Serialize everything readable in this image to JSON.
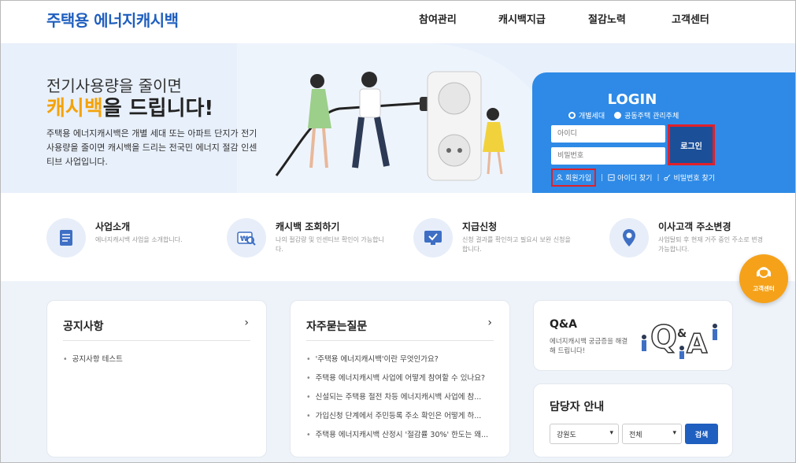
{
  "header": {
    "logo": "주택용 에너지캐시백",
    "nav": [
      "참여관리",
      "캐시백지급",
      "절감노력",
      "고객센터"
    ]
  },
  "hero": {
    "line1": "전기사용량을 줄이면",
    "line2_accent": "캐시백",
    "line2_rest": "을 드립니다!",
    "desc": "주택용 에너지캐시백은 개별 세대 또는 아파트 단지가 전기사용량을 줄이면 캐시백을 드리는 전국민 에너지 절감 인센티브 사업입니다."
  },
  "login": {
    "title": "LOGIN",
    "radio_household": "개별세대",
    "radio_apartment": "공동주택 관리주체",
    "id_placeholder": "아이디",
    "pw_placeholder": "비밀번호",
    "login_button": "로그인",
    "signup": "회원가입",
    "find_id": "아이디 찾기",
    "find_pw": "비밀번호 찾기"
  },
  "services": [
    {
      "title": "사업소개",
      "desc": "에너지캐시백 사업을 소개합니다."
    },
    {
      "title": "캐시백 조회하기",
      "desc": "나의 절감량 및 인센티브 확인이 가능합니다."
    },
    {
      "title": "지급신청",
      "desc": "신청 결과를 확인하고 필요시 보완 신청을 합니다."
    },
    {
      "title": "이사고객 주소변경",
      "desc": "사업탈퇴 후 현재 거주 중인 주소로 변경 가능합니다."
    }
  ],
  "notice": {
    "title": "공지사항",
    "arrow": "›",
    "items": [
      "공지사항 테스트"
    ]
  },
  "faq": {
    "title": "자주묻는질문",
    "arrow": "›",
    "items": [
      "'주택용 에너지캐시백'이란 무엇인가요?",
      "주택용 에너지캐시백 사업에 어떻게 참여할 수 있나요?",
      "신설되는 주택용 절전 차등 에너지캐시백 사업에 참...",
      "가입신청 단계에서 주민등록 주소 확인은 어떻게 하...",
      "주택용 에너지캐시백 산정시 '절감률 30%' 한도는 왜..."
    ]
  },
  "qa": {
    "title": "Q&A",
    "desc": "에너지캐시백 궁금증을 해결해 드립니다!"
  },
  "contact": {
    "title": "담당자 안내",
    "region": "강원도",
    "scope": "전체",
    "search": "검색"
  },
  "cs_float": "고객센터",
  "colors": {
    "brand": "#1f5fbf",
    "accent": "#f4a30b",
    "login_bg": "#2e8ae6",
    "highlight": "#e0202a"
  }
}
